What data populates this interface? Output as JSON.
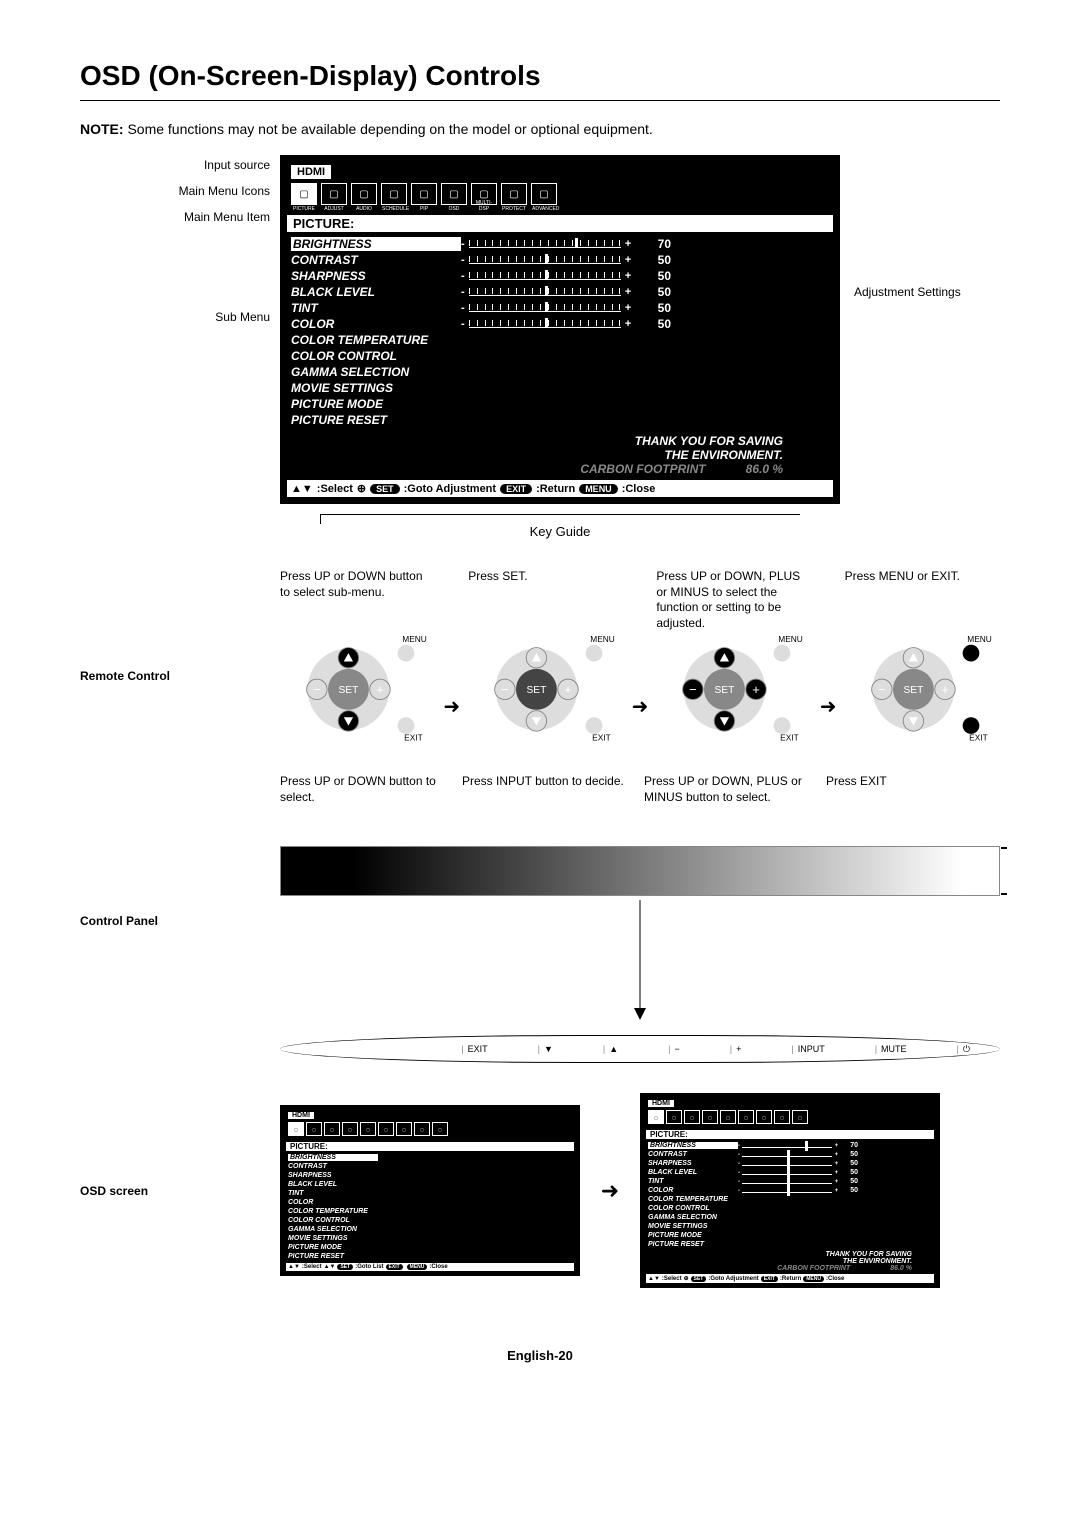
{
  "heading": "OSD (On-Screen-Display) Controls",
  "note_label": "NOTE:",
  "note_text": "Some functions may not be available depending on the model or optional equipment.",
  "labels": {
    "input_source": "Input source",
    "main_icons": "Main Menu Icons",
    "main_item": "Main Menu Item",
    "sub_menu": "Sub Menu",
    "adj_settings": "Adjustment Settings",
    "key_guide": "Key Guide",
    "remote": "Remote Control",
    "control_panel": "Control Panel",
    "osd_screen": "OSD screen"
  },
  "osd": {
    "input": "HDMI",
    "menu_title": "PICTURE:",
    "icons": [
      "PICTURE",
      "ADJUST",
      "AUDIO",
      "SCHEDULE",
      "PIP",
      "OSD",
      "MULTI-DSP",
      "PROTECT",
      "ADVANCED"
    ],
    "items": [
      {
        "name": "BRIGHTNESS",
        "val": "70",
        "slider": true,
        "pct": 70,
        "sel": true
      },
      {
        "name": "CONTRAST",
        "val": "50",
        "slider": true,
        "pct": 50
      },
      {
        "name": "SHARPNESS",
        "val": "50",
        "slider": true,
        "pct": 50
      },
      {
        "name": "BLACK LEVEL",
        "val": "50",
        "slider": true,
        "pct": 50
      },
      {
        "name": "TINT",
        "val": "50",
        "slider": true,
        "pct": 50
      },
      {
        "name": "COLOR",
        "val": "50",
        "slider": true,
        "pct": 50
      },
      {
        "name": "COLOR TEMPERATURE",
        "slider": false
      },
      {
        "name": "COLOR CONTROL",
        "slider": false
      },
      {
        "name": "GAMMA SELECTION",
        "slider": false
      },
      {
        "name": "MOVIE SETTINGS",
        "slider": false
      },
      {
        "name": "PICTURE MODE",
        "slider": false
      },
      {
        "name": "PICTURE RESET",
        "slider": false
      }
    ],
    "env1": "THANK YOU FOR SAVING",
    "env2": "THE ENVIRONMENT.",
    "carbon_label": "CARBON FOOTPRINT",
    "carbon_val": "86.0 %",
    "keyguide": {
      "select": ":Select",
      "goto_adj": ":Goto Adjustment",
      "goto_list": ":Goto List",
      "return": ":Return",
      "close": ":Close",
      "set": "SET",
      "exit": "EXIT",
      "menu": "MENU"
    }
  },
  "remote_steps": [
    "Press UP or DOWN button to select sub-menu.",
    "Press SET.",
    "Press UP or DOWN, PLUS or MINUS to select the function or setting to be adjusted.",
    "Press MENU or EXIT."
  ],
  "remote_highlight": [
    "updown",
    "set",
    "all",
    "menuexit"
  ],
  "cp_steps": [
    "Press UP or DOWN button to select.",
    "Press INPUT button to decide.",
    "Press UP or DOWN, PLUS or MINUS button to select.",
    "Press EXIT"
  ],
  "cp_buttons": [
    "EXIT",
    "▼",
    "▲",
    "−",
    "+",
    "INPUT",
    "MUTE",
    "⏻"
  ],
  "remote_labels": {
    "menu": "MENU",
    "exit": "EXIT",
    "set": "SET",
    "plus": "+",
    "minus": "−"
  },
  "page": "English-20"
}
